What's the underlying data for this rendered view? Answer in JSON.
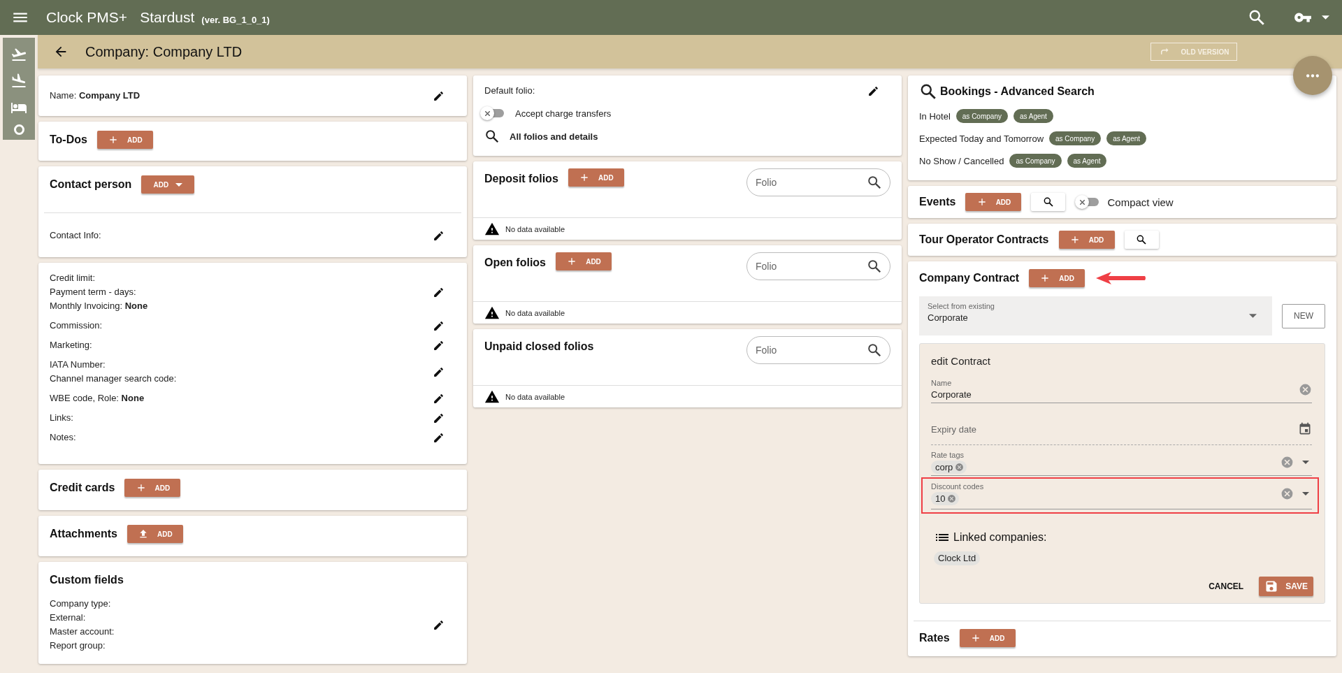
{
  "app": {
    "title": "Clock PMS+",
    "property": "Stardust",
    "version": "(ver. BG_1_0_1)"
  },
  "page": {
    "title": "Company: Company LTD",
    "old_version": "OLD VERSION"
  },
  "left_column": [
    {
      "items": [
        {
          "kind": "group",
          "lines": [
            "Name: **Company LTD**"
          ]
        }
      ]
    },
    {
      "title": "To-Dos",
      "button": {
        "label": "ADD",
        "kind": "add"
      }
    },
    {
      "title": "Contact person",
      "button": {
        "label": "ADD",
        "kind": "dropdown"
      },
      "divider": true,
      "items": [
        {
          "kind": "group",
          "lines": [
            "Contact Info:"
          ]
        }
      ]
    },
    {
      "items": [
        {
          "kind": "group",
          "lines": [
            "Credit limit:",
            "Payment term - days:",
            "Monthly Invoicing: **None**"
          ]
        },
        {
          "kind": "group",
          "lines": [
            "Commission:"
          ]
        },
        {
          "kind": "group",
          "lines": [
            "Marketing:"
          ]
        },
        {
          "kind": "group",
          "lines": [
            "IATA Number:",
            "Channel manager search code:"
          ]
        },
        {
          "kind": "group",
          "lines": [
            "WBE code, Role: **None**"
          ]
        },
        {
          "kind": "group",
          "lines": [
            "Links:"
          ]
        },
        {
          "kind": "group",
          "lines": [
            "Notes:"
          ]
        }
      ]
    },
    {
      "title": "Credit cards",
      "button": {
        "label": "ADD",
        "kind": "add"
      }
    },
    {
      "title": "Attachments",
      "button": {
        "label": "ADD",
        "kind": "upload"
      }
    },
    {
      "title": "Custom fields",
      "items": [
        {
          "kind": "group",
          "lines": [
            "Company type:",
            "External:",
            "Master account:",
            "Report group:"
          ]
        }
      ]
    }
  ],
  "middle_column": [
    {
      "items": [
        {
          "kind": "group",
          "lines": [
            "Default folio:"
          ]
        },
        {
          "kind": "toggle",
          "label": "Accept charge transfers",
          "on": false
        },
        {
          "kind": "link",
          "label": "All folios and details"
        }
      ]
    },
    {
      "title": "Deposit folios",
      "button": {
        "label": "ADD",
        "kind": "add"
      },
      "search": {
        "placeholder": "Folio"
      },
      "empty": "No data available"
    },
    {
      "title": "Open folios",
      "button": {
        "label": "ADD",
        "kind": "add"
      },
      "search": {
        "placeholder": "Folio"
      },
      "empty": "No data available"
    },
    {
      "title": "Unpaid closed folios",
      "search": {
        "placeholder": "Folio"
      },
      "empty": "No data available"
    }
  ],
  "bookings": {
    "title": "Bookings - Advanced Search",
    "rows": [
      {
        "label": "In Hotel",
        "chips": [
          "as Company",
          "as Agent"
        ]
      },
      {
        "label": "Expected Today and Tomorrow",
        "chips": [
          "as Company",
          "as Agent"
        ]
      },
      {
        "label": "No Show / Cancelled",
        "chips": [
          "as Company",
          "as Agent"
        ]
      }
    ]
  },
  "events": {
    "title": "Events",
    "button": {
      "label": "ADD",
      "kind": "add"
    },
    "search_button": true,
    "toggle": {
      "label": "Compact view",
      "on": false
    }
  },
  "tour_operator_contracts": {
    "title": "Tour Operator Contracts",
    "button": {
      "label": "ADD",
      "kind": "add"
    },
    "search_button": true
  },
  "company_contract": {
    "title": "Company Contract",
    "button": {
      "label": "ADD",
      "kind": "add"
    },
    "annotation_arrow": true,
    "select": {
      "label": "Select from existing",
      "value": "Corporate"
    },
    "new_button": "NEW",
    "editor": {
      "title": "edit Contract",
      "fields": [
        {
          "kind": "text",
          "label": "Name",
          "value": "Corporate",
          "highlighted": false
        },
        {
          "kind": "date",
          "placeholder": "Expiry date",
          "highlighted": false
        },
        {
          "kind": "chips",
          "label": "Rate tags",
          "chips": [
            "corp"
          ],
          "highlighted": false
        },
        {
          "kind": "chips",
          "label": "Discount codes",
          "chips": [
            "10"
          ],
          "highlighted": true
        }
      ],
      "linked": {
        "title": "Linked companies:",
        "chips": [
          "Clock Ltd"
        ]
      },
      "cancel": "CANCEL",
      "save": "SAVE"
    }
  },
  "rates": {
    "title": "Rates",
    "button": {
      "label": "ADD",
      "kind": "add"
    }
  }
}
